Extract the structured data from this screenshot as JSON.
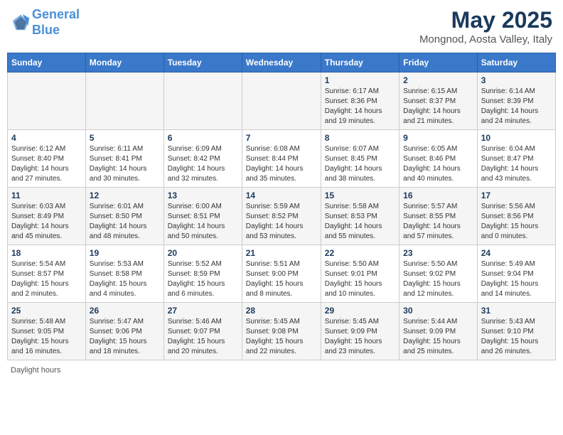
{
  "header": {
    "logo_line1": "General",
    "logo_line2": "Blue",
    "month_year": "May 2025",
    "location": "Mongnod, Aosta Valley, Italy"
  },
  "days_of_week": [
    "Sunday",
    "Monday",
    "Tuesday",
    "Wednesday",
    "Thursday",
    "Friday",
    "Saturday"
  ],
  "weeks": [
    [
      {
        "day": "",
        "info": ""
      },
      {
        "day": "",
        "info": ""
      },
      {
        "day": "",
        "info": ""
      },
      {
        "day": "",
        "info": ""
      },
      {
        "day": "1",
        "info": "Sunrise: 6:17 AM\nSunset: 8:36 PM\nDaylight: 14 hours\nand 19 minutes."
      },
      {
        "day": "2",
        "info": "Sunrise: 6:15 AM\nSunset: 8:37 PM\nDaylight: 14 hours\nand 21 minutes."
      },
      {
        "day": "3",
        "info": "Sunrise: 6:14 AM\nSunset: 8:39 PM\nDaylight: 14 hours\nand 24 minutes."
      }
    ],
    [
      {
        "day": "4",
        "info": "Sunrise: 6:12 AM\nSunset: 8:40 PM\nDaylight: 14 hours\nand 27 minutes."
      },
      {
        "day": "5",
        "info": "Sunrise: 6:11 AM\nSunset: 8:41 PM\nDaylight: 14 hours\nand 30 minutes."
      },
      {
        "day": "6",
        "info": "Sunrise: 6:09 AM\nSunset: 8:42 PM\nDaylight: 14 hours\nand 32 minutes."
      },
      {
        "day": "7",
        "info": "Sunrise: 6:08 AM\nSunset: 8:44 PM\nDaylight: 14 hours\nand 35 minutes."
      },
      {
        "day": "8",
        "info": "Sunrise: 6:07 AM\nSunset: 8:45 PM\nDaylight: 14 hours\nand 38 minutes."
      },
      {
        "day": "9",
        "info": "Sunrise: 6:05 AM\nSunset: 8:46 PM\nDaylight: 14 hours\nand 40 minutes."
      },
      {
        "day": "10",
        "info": "Sunrise: 6:04 AM\nSunset: 8:47 PM\nDaylight: 14 hours\nand 43 minutes."
      }
    ],
    [
      {
        "day": "11",
        "info": "Sunrise: 6:03 AM\nSunset: 8:49 PM\nDaylight: 14 hours\nand 45 minutes."
      },
      {
        "day": "12",
        "info": "Sunrise: 6:01 AM\nSunset: 8:50 PM\nDaylight: 14 hours\nand 48 minutes."
      },
      {
        "day": "13",
        "info": "Sunrise: 6:00 AM\nSunset: 8:51 PM\nDaylight: 14 hours\nand 50 minutes."
      },
      {
        "day": "14",
        "info": "Sunrise: 5:59 AM\nSunset: 8:52 PM\nDaylight: 14 hours\nand 53 minutes."
      },
      {
        "day": "15",
        "info": "Sunrise: 5:58 AM\nSunset: 8:53 PM\nDaylight: 14 hours\nand 55 minutes."
      },
      {
        "day": "16",
        "info": "Sunrise: 5:57 AM\nSunset: 8:55 PM\nDaylight: 14 hours\nand 57 minutes."
      },
      {
        "day": "17",
        "info": "Sunrise: 5:56 AM\nSunset: 8:56 PM\nDaylight: 15 hours\nand 0 minutes."
      }
    ],
    [
      {
        "day": "18",
        "info": "Sunrise: 5:54 AM\nSunset: 8:57 PM\nDaylight: 15 hours\nand 2 minutes."
      },
      {
        "day": "19",
        "info": "Sunrise: 5:53 AM\nSunset: 8:58 PM\nDaylight: 15 hours\nand 4 minutes."
      },
      {
        "day": "20",
        "info": "Sunrise: 5:52 AM\nSunset: 8:59 PM\nDaylight: 15 hours\nand 6 minutes."
      },
      {
        "day": "21",
        "info": "Sunrise: 5:51 AM\nSunset: 9:00 PM\nDaylight: 15 hours\nand 8 minutes."
      },
      {
        "day": "22",
        "info": "Sunrise: 5:50 AM\nSunset: 9:01 PM\nDaylight: 15 hours\nand 10 minutes."
      },
      {
        "day": "23",
        "info": "Sunrise: 5:50 AM\nSunset: 9:02 PM\nDaylight: 15 hours\nand 12 minutes."
      },
      {
        "day": "24",
        "info": "Sunrise: 5:49 AM\nSunset: 9:04 PM\nDaylight: 15 hours\nand 14 minutes."
      }
    ],
    [
      {
        "day": "25",
        "info": "Sunrise: 5:48 AM\nSunset: 9:05 PM\nDaylight: 15 hours\nand 16 minutes."
      },
      {
        "day": "26",
        "info": "Sunrise: 5:47 AM\nSunset: 9:06 PM\nDaylight: 15 hours\nand 18 minutes."
      },
      {
        "day": "27",
        "info": "Sunrise: 5:46 AM\nSunset: 9:07 PM\nDaylight: 15 hours\nand 20 minutes."
      },
      {
        "day": "28",
        "info": "Sunrise: 5:45 AM\nSunset: 9:08 PM\nDaylight: 15 hours\nand 22 minutes."
      },
      {
        "day": "29",
        "info": "Sunrise: 5:45 AM\nSunset: 9:09 PM\nDaylight: 15 hours\nand 23 minutes."
      },
      {
        "day": "30",
        "info": "Sunrise: 5:44 AM\nSunset: 9:09 PM\nDaylight: 15 hours\nand 25 minutes."
      },
      {
        "day": "31",
        "info": "Sunrise: 5:43 AM\nSunset: 9:10 PM\nDaylight: 15 hours\nand 26 minutes."
      }
    ]
  ],
  "legend": {
    "daylight_hours": "Daylight hours"
  }
}
